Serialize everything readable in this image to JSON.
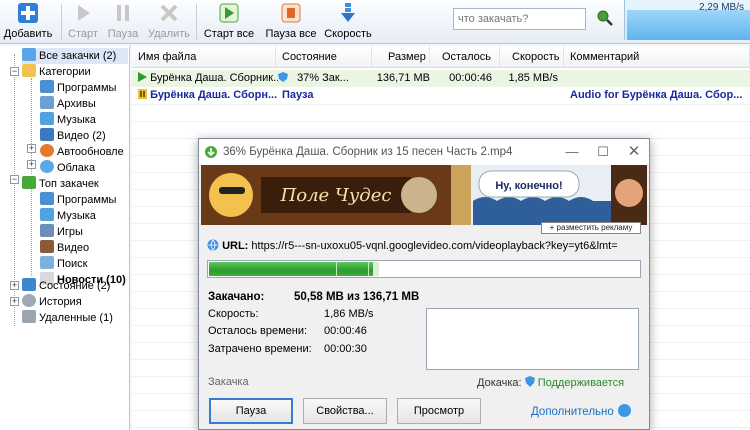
{
  "toolbar": {
    "buttons": [
      {
        "label": "Добавить",
        "icon": "plus-icon",
        "enabled": true
      },
      {
        "label": "Старт",
        "icon": "play-icon",
        "enabled": false
      },
      {
        "label": "Пауза",
        "icon": "pause-icon",
        "enabled": false
      },
      {
        "label": "Удалить",
        "icon": "delete-x-icon",
        "enabled": false
      },
      {
        "label": "Старт все",
        "icon": "start-all-icon",
        "enabled": true
      },
      {
        "label": "Пауза все",
        "icon": "pause-all-icon",
        "enabled": true
      },
      {
        "label": "Скорость",
        "icon": "speed-arrow-icon",
        "enabled": true
      }
    ],
    "search_placeholder": "что закачать?",
    "speed_graph_value": "2,29 MB/s",
    "speed_graph_level": 0.75
  },
  "tree": {
    "items": [
      {
        "label": "Все закачки (2)",
        "icon": "all-downloads-icon",
        "bold": false,
        "selected": true
      },
      {
        "label": "Категории",
        "icon": "categories-folder-icon"
      },
      {
        "label": "Программы",
        "icon": "programs-icon"
      },
      {
        "label": "Архивы",
        "icon": "archives-icon"
      },
      {
        "label": "Музыка",
        "icon": "music-icon"
      },
      {
        "label": "Видео (2)",
        "icon": "video-icon"
      },
      {
        "label": "Автообновле",
        "icon": "autoupdate-icon"
      },
      {
        "label": "Облака",
        "icon": "cloud-icon"
      },
      {
        "label": "Топ закачек",
        "icon": "top-downloads-icon"
      },
      {
        "label": "Программы",
        "icon": "programs-icon"
      },
      {
        "label": "Музыка",
        "icon": "music-icon"
      },
      {
        "label": "Игры",
        "icon": "games-icon"
      },
      {
        "label": "Видео",
        "icon": "video-icon"
      },
      {
        "label": "Поиск",
        "icon": "search-icon"
      },
      {
        "label": "Новости (10)",
        "icon": "news-icon",
        "bold": true
      },
      {
        "label": "Состояние (2)",
        "icon": "state-icon"
      },
      {
        "label": "История",
        "icon": "history-icon"
      },
      {
        "label": "Удаленные (1)",
        "icon": "trash-icon"
      }
    ]
  },
  "list": {
    "columns": [
      "Имя файла",
      "Состояние",
      "Размер",
      "Осталось",
      "Скорость",
      "Комментарий"
    ],
    "rows": [
      {
        "name": "Бурёнка Даша. Сборник...",
        "state": "37% Зак...",
        "size": "136,71 MB",
        "left": "00:00:46",
        "speed": "1,85 MB/s",
        "comment": "",
        "status": "downloading"
      },
      {
        "name": "Бурёнка Даша. Сборн...",
        "state": "Пауза",
        "size": "",
        "left": "",
        "speed": "",
        "comment": "Audio for Бурёнка Даша. Сбор...",
        "status": "paused"
      }
    ]
  },
  "dialog": {
    "title": "36% Бурёнка Даша. Сборник из 15 песен  Часть 2.mp4",
    "banner_text": "Ну, конечно!",
    "banner_logo": "Поле Чудес",
    "banner_ad_label": "+ разместить рекламу",
    "url_label": "URL:",
    "url_value": "https://r5---sn-uxoxu05-vqnl.googlevideo.com/videoplayback?key=yt6&lmt=",
    "progress": 0.38,
    "downloaded_label": "Закачано:",
    "downloaded_value": "50,58 MB из 136,71 MB",
    "speed_label": "Скорость:",
    "speed_value": "1,86 MB/s",
    "remaining_label": "Осталось времени:",
    "remaining_value": "00:00:46",
    "spent_label": "Затрачено времени:",
    "spent_value": "00:00:30",
    "section_label": "Закачка",
    "resume_label": "Докачка:",
    "resume_value": "Поддерживается",
    "buttons": {
      "pause": "Пауза",
      "properties": "Свойства...",
      "view": "Просмотр"
    },
    "more_link": "Дополнительно"
  },
  "colors": {
    "accent": "#3a7bd5",
    "progress": "#2c9b2c",
    "paused_text": "#1a2a9c",
    "link": "#1c6fc2"
  }
}
